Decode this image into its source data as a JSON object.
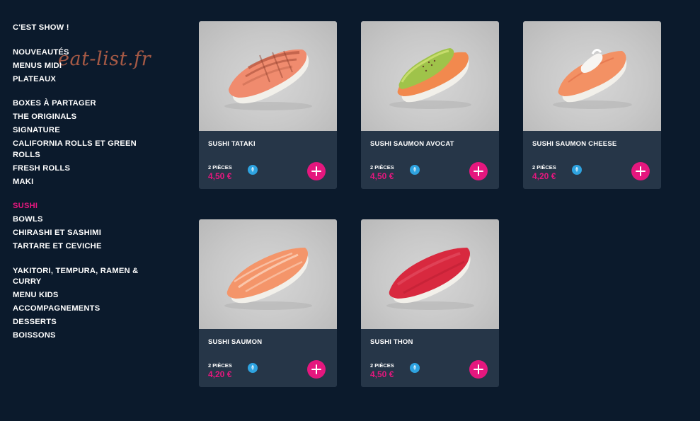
{
  "watermark": "eat-list.fr",
  "sidebar": {
    "groups": [
      [
        "C'EST SHOW !"
      ],
      [
        "NOUVEAUTÉS",
        "MENUS MIDI",
        "PLATEAUX"
      ],
      [
        "BOXES À PARTAGER",
        "THE ORIGINALS",
        "SIGNATURE",
        "CALIFORNIA ROLLS ET GREEN ROLLS",
        "FRESH ROLLS",
        "MAKI"
      ],
      [
        "SUSHI",
        "BOWLS",
        "CHIRASHI ET SASHIMI",
        "TARTARE ET CEVICHE"
      ],
      [
        "YAKITORI, TEMPURA, RAMEN & CURRY",
        "MENU KIDS",
        "ACCOMPAGNEMENTS",
        "DESSERTS",
        "BOISSONS"
      ]
    ],
    "active": "SUSHI"
  },
  "products": [
    {
      "name": "SUSHI TATAKI",
      "pieces": "2 PIÈCES",
      "price": "4,50 €",
      "icon": "veggie-leaf-icon"
    },
    {
      "name": "SUSHI SAUMON AVOCAT",
      "pieces": "2 PIÈCES",
      "price": "4,50 €",
      "icon": "veggie-leaf-icon"
    },
    {
      "name": "SUSHI SAUMON CHEESE",
      "pieces": "2 PIÈCES",
      "price": "4,20 €",
      "icon": "veggie-leaf-icon"
    },
    {
      "name": "SUSHI SAUMON",
      "pieces": "2 PIÈCES",
      "price": "4,20 €",
      "icon": "veggie-leaf-icon"
    },
    {
      "name": "SUSHI THON",
      "pieces": "2 PIÈCES",
      "price": "4,50 €",
      "icon": "veggie-leaf-icon"
    }
  ],
  "colors": {
    "background": "#0b1a2c",
    "card": "#263648",
    "accent": "#e5177e",
    "veggie_badge": "#2ea3e0"
  }
}
